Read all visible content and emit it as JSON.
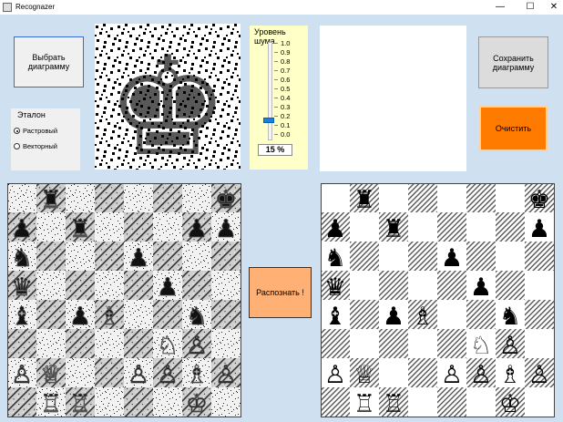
{
  "window": {
    "title": "Recognazer",
    "minimize_glyph": "—",
    "maximize_glyph": "☐",
    "close_glyph": "✕"
  },
  "buttons": {
    "choose": "Выбрать диаграмму",
    "save": "Сохранить диаграмму",
    "clear": "Очистить",
    "recognize": "Распознать !"
  },
  "reference": {
    "title": "Эталон",
    "options": [
      {
        "label": "Растровый",
        "selected": true
      },
      {
        "label": "Векторный",
        "selected": false
      }
    ]
  },
  "noise": {
    "title": "Уровень шума",
    "ticks": [
      "1.0",
      "0.9",
      "0.8",
      "0.7",
      "0.6",
      "0.5",
      "0.4",
      "0.3",
      "0.2",
      "0.1",
      "0.0"
    ],
    "level": 0.15,
    "percent_text": "15 %"
  },
  "template_piece": {
    "icon": "black-king-icon"
  },
  "colors": {
    "clear_button": "#ff7b00",
    "recognize_button": "#ffb074",
    "noise_panel": "#ffffc8",
    "background": "#cfe0f0"
  },
  "noisy_board": {
    "pieces": [
      {
        "r": 0,
        "c": 1,
        "g": "♜"
      },
      {
        "r": 0,
        "c": 7,
        "g": "♚"
      },
      {
        "r": 1,
        "c": 0,
        "g": "♟"
      },
      {
        "r": 1,
        "c": 2,
        "g": "♜"
      },
      {
        "r": 1,
        "c": 6,
        "g": "♟"
      },
      {
        "r": 1,
        "c": 7,
        "g": "♟"
      },
      {
        "r": 2,
        "c": 0,
        "g": "♞"
      },
      {
        "r": 2,
        "c": 4,
        "g": "♟"
      },
      {
        "r": 3,
        "c": 0,
        "g": "♛"
      },
      {
        "r": 3,
        "c": 5,
        "g": "♟"
      },
      {
        "r": 4,
        "c": 0,
        "g": "♝"
      },
      {
        "r": 4,
        "c": 2,
        "g": "♟"
      },
      {
        "r": 4,
        "c": 3,
        "g": "♗"
      },
      {
        "r": 4,
        "c": 6,
        "g": "♞"
      },
      {
        "r": 5,
        "c": 5,
        "g": "♘"
      },
      {
        "r": 5,
        "c": 6,
        "g": "♙"
      },
      {
        "r": 6,
        "c": 0,
        "g": "♙"
      },
      {
        "r": 6,
        "c": 1,
        "g": "♕"
      },
      {
        "r": 6,
        "c": 4,
        "g": "♙"
      },
      {
        "r": 6,
        "c": 5,
        "g": "♙"
      },
      {
        "r": 6,
        "c": 6,
        "g": "♗"
      },
      {
        "r": 6,
        "c": 7,
        "g": "♙"
      },
      {
        "r": 7,
        "c": 1,
        "g": "♖"
      },
      {
        "r": 7,
        "c": 2,
        "g": "♖"
      },
      {
        "r": 7,
        "c": 6,
        "g": "♔"
      }
    ]
  },
  "recognized_board": {
    "pieces": [
      {
        "r": 0,
        "c": 1,
        "g": "♜"
      },
      {
        "r": 0,
        "c": 7,
        "g": "♚"
      },
      {
        "r": 1,
        "c": 0,
        "g": "♟"
      },
      {
        "r": 1,
        "c": 2,
        "g": "♜"
      },
      {
        "r": 1,
        "c": 7,
        "g": "♟"
      },
      {
        "r": 2,
        "c": 0,
        "g": "♞"
      },
      {
        "r": 2,
        "c": 4,
        "g": "♟"
      },
      {
        "r": 3,
        "c": 0,
        "g": "♛"
      },
      {
        "r": 3,
        "c": 5,
        "g": "♟"
      },
      {
        "r": 4,
        "c": 0,
        "g": "♝"
      },
      {
        "r": 4,
        "c": 2,
        "g": "♟"
      },
      {
        "r": 4,
        "c": 3,
        "g": "♗"
      },
      {
        "r": 4,
        "c": 6,
        "g": "♞"
      },
      {
        "r": 5,
        "c": 5,
        "g": "♘"
      },
      {
        "r": 5,
        "c": 6,
        "g": "♙"
      },
      {
        "r": 6,
        "c": 0,
        "g": "♙"
      },
      {
        "r": 6,
        "c": 1,
        "g": "♕"
      },
      {
        "r": 6,
        "c": 4,
        "g": "♙"
      },
      {
        "r": 6,
        "c": 5,
        "g": "♙"
      },
      {
        "r": 6,
        "c": 6,
        "g": "♗"
      },
      {
        "r": 6,
        "c": 7,
        "g": "♙"
      },
      {
        "r": 7,
        "c": 1,
        "g": "♖"
      },
      {
        "r": 7,
        "c": 2,
        "g": "♖"
      },
      {
        "r": 7,
        "c": 6,
        "g": "♔"
      }
    ]
  }
}
